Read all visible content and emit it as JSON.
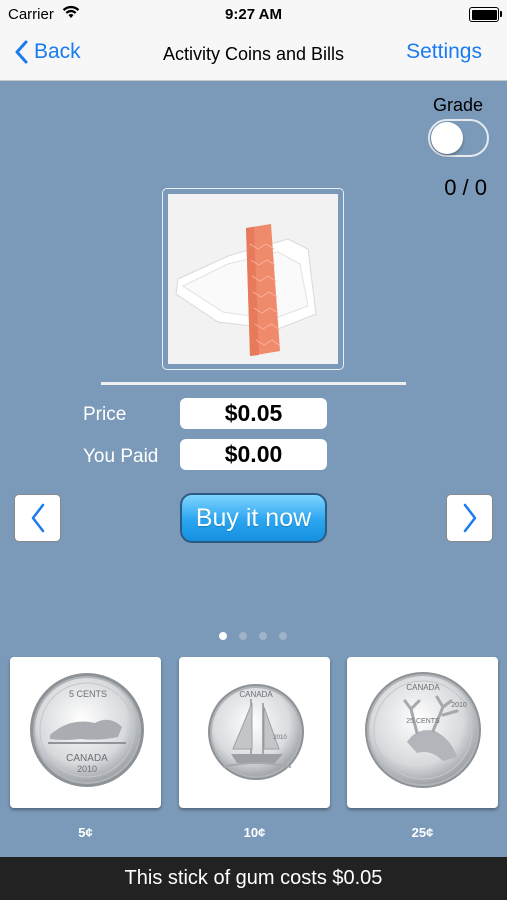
{
  "status": {
    "carrier": "Carrier",
    "time": "9:27 AM"
  },
  "nav": {
    "back_label": "Back",
    "title": "Activity Coins and Bills",
    "settings_label": "Settings"
  },
  "grade": {
    "label": "Grade",
    "toggle_on": false,
    "score": "0 / 0"
  },
  "product": {
    "name": "stick of gum"
  },
  "price": {
    "label": "Price",
    "value": "$0.05"
  },
  "paid": {
    "label": "You Paid",
    "value": "$0.00"
  },
  "buy_label": "Buy it now",
  "pager": {
    "pages": 4,
    "active": 1
  },
  "coins": [
    {
      "label": "5¢",
      "engraving_top": "5 CENTS",
      "engraving_bottom": "CANADA",
      "year": "2010",
      "icon": "beaver-nickel-icon"
    },
    {
      "label": "10¢",
      "engraving_top": "CANADA",
      "year": "2010",
      "icon": "bluenose-dime-icon"
    },
    {
      "label": "25¢",
      "engraving_top": "CANADA",
      "engraving_denomination": "25 CENTS",
      "year": "2010",
      "icon": "caribou-quarter-icon"
    }
  ],
  "message": "This stick of gum costs $0.05",
  "colors": {
    "background": "#7b9ab9",
    "accent": "#1a7cf0",
    "buy_button": "#2aa5f0",
    "bottom_bar": "#222222"
  }
}
